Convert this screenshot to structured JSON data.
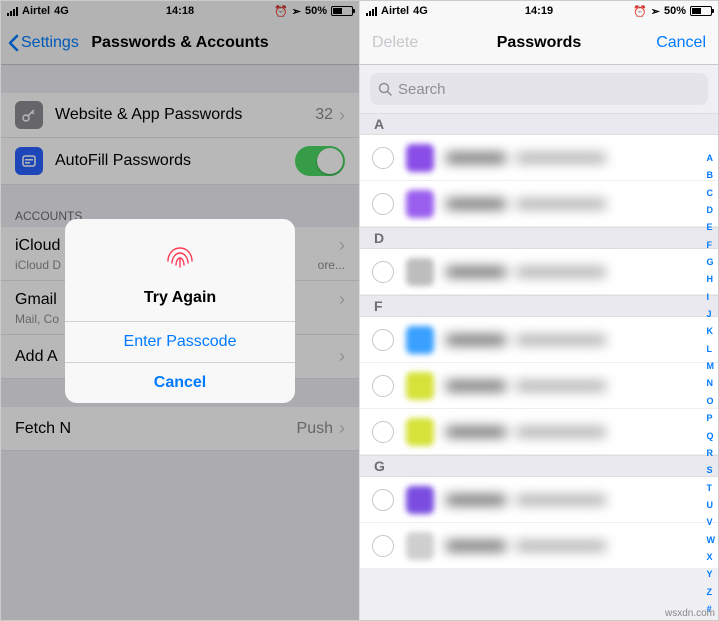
{
  "left": {
    "status": {
      "carrier": "Airtel",
      "network": "4G",
      "time": "14:18",
      "battery": "50%"
    },
    "nav": {
      "back": "Settings",
      "title": "Passwords & Accounts"
    },
    "rows": {
      "websites": {
        "label": "Website & App Passwords",
        "count": "32"
      },
      "autofill": {
        "label": "AutoFill Passwords"
      }
    },
    "accounts_header": "ACCOUNTS",
    "accounts": {
      "icloud": {
        "title": "iCloud",
        "sub_prefix": "iCloud D",
        "sub_suffix": "ore..."
      },
      "gmail": {
        "title": "Gmail",
        "sub_prefix": "Mail, Co"
      },
      "add": {
        "title_prefix": "Add A"
      }
    },
    "fetch": {
      "title_prefix": "Fetch N",
      "value_suffix": "Push"
    },
    "alert": {
      "title": "Try Again",
      "primary": "Enter Passcode",
      "cancel": "Cancel"
    }
  },
  "right": {
    "status": {
      "carrier": "Airtel",
      "network": "4G",
      "time": "14:19",
      "battery": "50%"
    },
    "nav": {
      "left": "Delete",
      "title": "Passwords",
      "right": "Cancel"
    },
    "search_placeholder": "Search",
    "sections": [
      {
        "letter": "A",
        "rows": [
          {
            "color": "#8a4ee8"
          },
          {
            "color": "#9b5ff0"
          }
        ]
      },
      {
        "letter": "D",
        "rows": [
          {
            "color": "#bdbdbd"
          }
        ]
      },
      {
        "letter": "F",
        "rows": [
          {
            "color": "#3aa0ff"
          },
          {
            "color": "#d6e23a"
          },
          {
            "color": "#d6e23a"
          }
        ]
      },
      {
        "letter": "G",
        "rows": [
          {
            "color": "#7a4de0"
          },
          {
            "color": "#cfcfcf"
          }
        ]
      }
    ],
    "index_rail": [
      "A",
      "B",
      "C",
      "D",
      "E",
      "F",
      "G",
      "H",
      "I",
      "J",
      "K",
      "L",
      "M",
      "N",
      "O",
      "P",
      "Q",
      "R",
      "S",
      "T",
      "U",
      "V",
      "W",
      "X",
      "Y",
      "Z",
      "#"
    ]
  },
  "watermark": "wsxdn.com"
}
